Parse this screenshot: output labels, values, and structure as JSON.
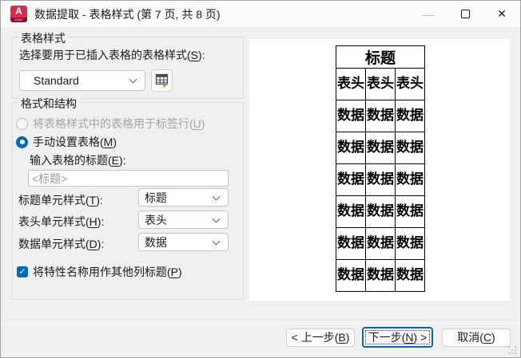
{
  "window": {
    "title": "数据提取 - 表格样式 (第 7 页, 共 8 页)",
    "app_icon_letter": "A",
    "app_icon_sub": "CAD",
    "minimize_glyph": "—",
    "close_glyph": "✕"
  },
  "table_style_group": {
    "title": "表格样式",
    "select_label": "选择要用于已插入表格的表格样式(S):",
    "style_value": "Standard"
  },
  "format_group": {
    "title": "格式和结构",
    "radio_use_style_table": "将表格样式中的表格用于标签行(U)",
    "radio_manual": "手动设置表格(M)",
    "title_input_label": "输入表格的标题(E):",
    "title_input_value": "<标题>",
    "title_cell_label": "标题单元样式(T):",
    "title_cell_value": "标题",
    "header_cell_label": "表头单元样式(H):",
    "header_cell_value": "表头",
    "data_cell_label": "数据单元样式(D):",
    "data_cell_value": "数据",
    "checkbox_label": "将特性名称用作其他列标题(P)",
    "checkbox_checked": "✓"
  },
  "preview": {
    "title_cell": "标题",
    "header_cells": [
      "表头",
      "表头",
      "表头"
    ],
    "data_cell": "数据",
    "data_rows": 6,
    "columns": 3
  },
  "footer": {
    "back_label": "< 上一步(B)",
    "next_label": "下一步(N) >",
    "cancel_label": "取消(C)"
  },
  "colors": {
    "accent": "#0067c0",
    "autocad_red": "#e02a4d",
    "preview_bg": "#ffffff",
    "dialog_bg": "#f0f0f0"
  }
}
